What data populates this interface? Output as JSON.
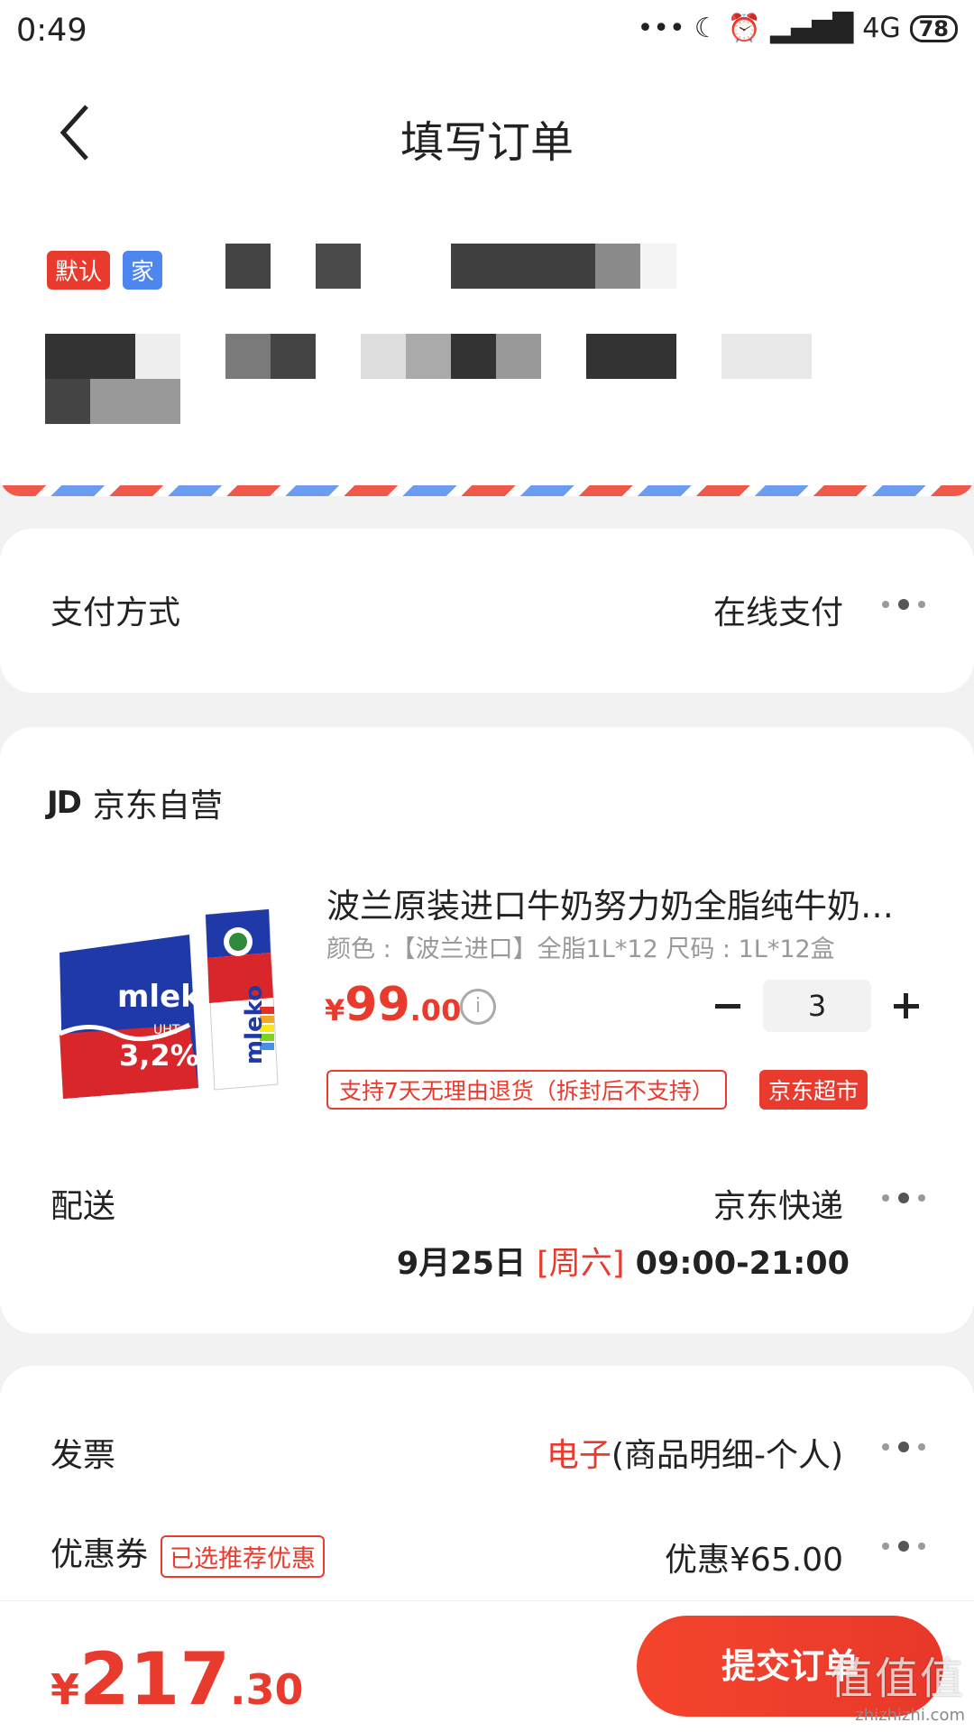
{
  "status_bar": {
    "time": "0:49",
    "signal": "4G",
    "battery": "78"
  },
  "header": {
    "title": "填写订单"
  },
  "address": {
    "tag_default": "默认",
    "tag_home": "家"
  },
  "payment": {
    "label": "支付方式",
    "value": "在线支付"
  },
  "shop": {
    "logo": "JD",
    "name": "京东自营"
  },
  "product": {
    "title": "波兰原装进口牛奶努力奶全脂纯牛奶…",
    "spec": "颜色 :【波兰进口】全脂1L*12   尺码 : 1L*12盒",
    "price_currency": "¥",
    "price_int": "99",
    "price_dec": ".00",
    "quantity": "3",
    "service_tag": "支持7天无理由退货（拆封后不支持）",
    "market_tag": "京东超市",
    "image_text": {
      "brand": "mleko",
      "fat": "3,2%",
      "uht": "UHT"
    }
  },
  "delivery": {
    "label": "配送",
    "carrier": "京东快递",
    "date": "9月25日 ",
    "weekday": "[周六]",
    "hours": " 09:00-21:00"
  },
  "invoice": {
    "label": "发票",
    "value_type": "电子",
    "value_detail": "(商品明细-个人)"
  },
  "coupon": {
    "label": "优惠券",
    "tag": "已选推荐优惠",
    "value": "优惠¥65.00"
  },
  "bottom": {
    "total_currency": "¥",
    "total_int": "217",
    "total_dec": ".30",
    "submit_label": "提交订单"
  },
  "watermark": {
    "glyph": "值值值",
    "url": "zhizhizhi.com"
  },
  "colors": {
    "accent_red": "#e93b2d",
    "tag_blue": "#4e86f0"
  }
}
